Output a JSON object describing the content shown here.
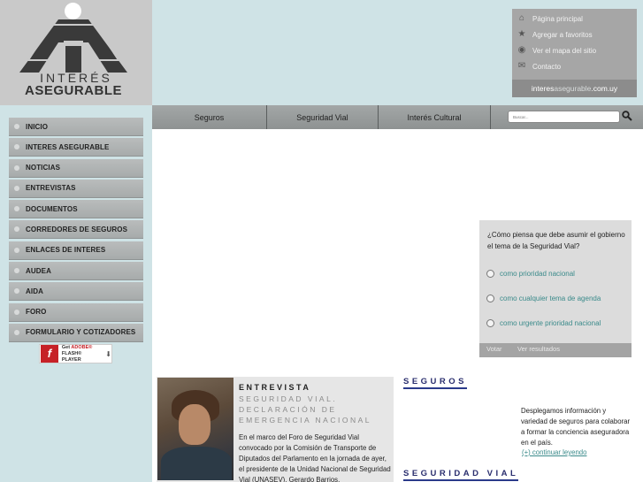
{
  "logo": {
    "line1": "INTERÉS",
    "line2": "ASEGURABLE"
  },
  "quick_links": [
    {
      "icon": "home-icon",
      "label": "Página principal"
    },
    {
      "icon": "star-icon",
      "label": "Agregar a favoritos"
    },
    {
      "icon": "sitemap-icon",
      "label": "Ver el mapa del sitio"
    },
    {
      "icon": "mail-icon",
      "label": "Contacto"
    }
  ],
  "domain": {
    "part1": "interes",
    "part2": "asegurable",
    "part3": ".com.uy"
  },
  "sidebar": {
    "items": [
      "INICIO",
      "INTERES ASEGURABLE",
      "NOTICIAS",
      "ENTREVISTAS",
      "DOCUMENTOS",
      "CORREDORES DE SEGUROS",
      "ENLACES DE INTERES",
      "AUDEA",
      "AIDA",
      "FORO",
      "FORMULARIO Y COTIZADORES"
    ]
  },
  "flash": {
    "get": "Get",
    "adobe": "ADOBE®",
    "player": "FLASH® PLAYER"
  },
  "topnav": {
    "tabs": [
      "Seguros",
      "Seguridad Vial",
      "Interés Cultural"
    ],
    "search_placeholder": "Buscar..."
  },
  "poll": {
    "question": "¿Cómo piensa que debe asumir el gobierno el tema de la Seguridad Vial?",
    "options": [
      "como prioridad nacional",
      "como cualquier tema de agenda",
      "como urgente prioridad nacional"
    ],
    "vote_label": "Votar",
    "results_label": "Ver resultados"
  },
  "interview": {
    "kicker": "ENTREVISTA",
    "subtitle": "SEGURIDAD VIAL. DECLARACIÓN DE EMERGENCIA NACIONAL",
    "body": "En el marco del Foro de Seguridad Vial convocado por la Comisión de Transporte de Diputados del Parlamento en la jornada de ayer, el presidente de la Unidad Nacional de Seguridad Vial (UNASEV), Gerardo Barrios,"
  },
  "sections": {
    "seguros_title": "SEGUROS",
    "seguros_text": "Desplegamos información y variedad de seguros para colaborar a formar la conciencia aseguradora en el país.",
    "seguros_link": "(+) continuar leyendo",
    "seguridad_title": "SEGURIDAD VIAL"
  }
}
